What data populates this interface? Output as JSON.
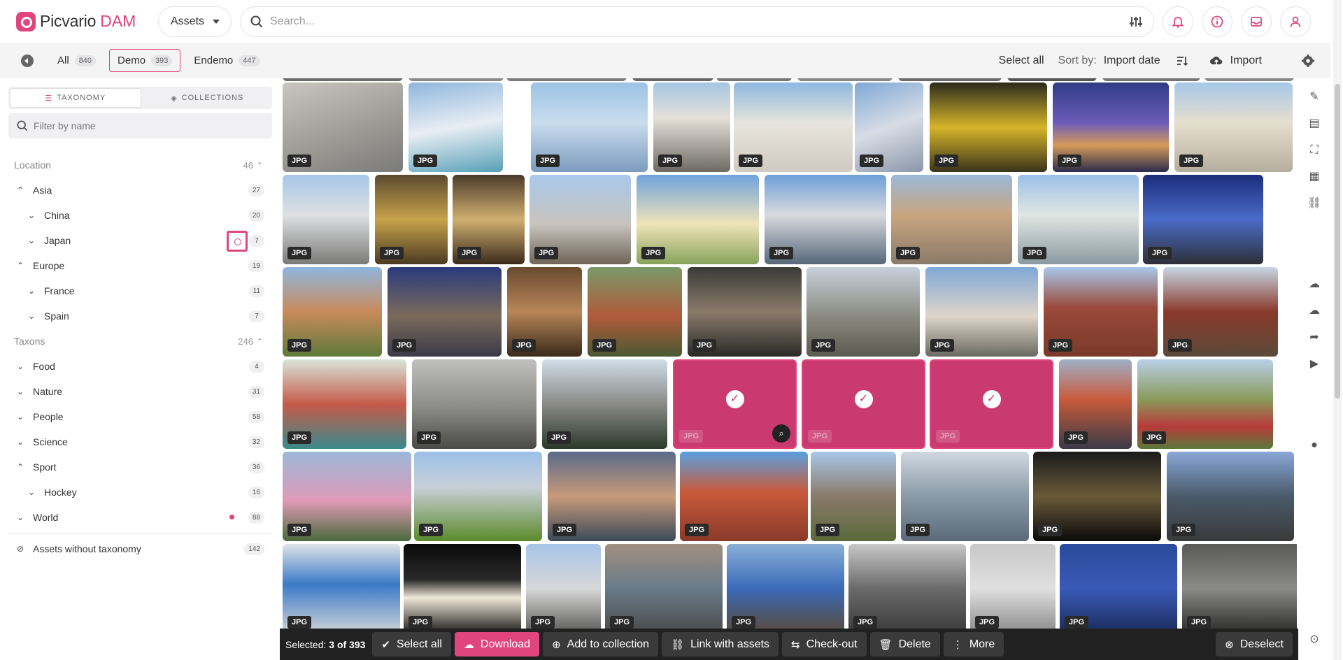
{
  "brand": {
    "name": "Picvario",
    "suffix": "DAM",
    "accent": "#e0457b"
  },
  "header": {
    "assets_label": "Assets",
    "search_placeholder": "Search..."
  },
  "scopes": [
    {
      "label": "All",
      "count": "840"
    },
    {
      "label": "Demo",
      "count": "393"
    },
    {
      "label": "Endemo",
      "count": "447"
    }
  ],
  "toolbar": {
    "select_all": "Select all",
    "sort_label": "Sort by:",
    "sort_value": "Import date",
    "import_label": "Import"
  },
  "sidebar": {
    "tab_taxonomy": "TAXONOMY",
    "tab_collections": "COLLECTIONS",
    "filter_placeholder": "Filter by name",
    "location": {
      "label": "Location",
      "count": "46"
    },
    "asia": {
      "label": "Asia",
      "count": "27"
    },
    "china": {
      "label": "China",
      "count": "20"
    },
    "japan": {
      "label": "Japan",
      "count": "7"
    },
    "europe": {
      "label": "Europe",
      "count": "19"
    },
    "france": {
      "label": "France",
      "count": "11"
    },
    "spain": {
      "label": "Spain",
      "count": "7"
    },
    "taxons": {
      "label": "Taxons",
      "count": "246"
    },
    "food": {
      "label": "Food",
      "count": "4"
    },
    "nature": {
      "label": "Nature",
      "count": "31"
    },
    "people": {
      "label": "People",
      "count": "58"
    },
    "science": {
      "label": "Science",
      "count": "32"
    },
    "sport": {
      "label": "Sport",
      "count": "36"
    },
    "hockey": {
      "label": "Hockey",
      "count": "16"
    },
    "world": {
      "label": "World",
      "count": "88"
    },
    "without": {
      "label": "Assets without taxonomy",
      "count": "142"
    }
  },
  "grid": {
    "badge": "JPG"
  },
  "actionbar": {
    "selected_prefix": "Selected:",
    "selected_value": "3 of 393",
    "select_all": "Select all",
    "download": "Download",
    "add_to_collection": "Add to collection",
    "link_with_assets": "Link with assets",
    "check_out": "Check-out",
    "delete": "Delete",
    "more": "More",
    "deselect": "Deselect"
  }
}
